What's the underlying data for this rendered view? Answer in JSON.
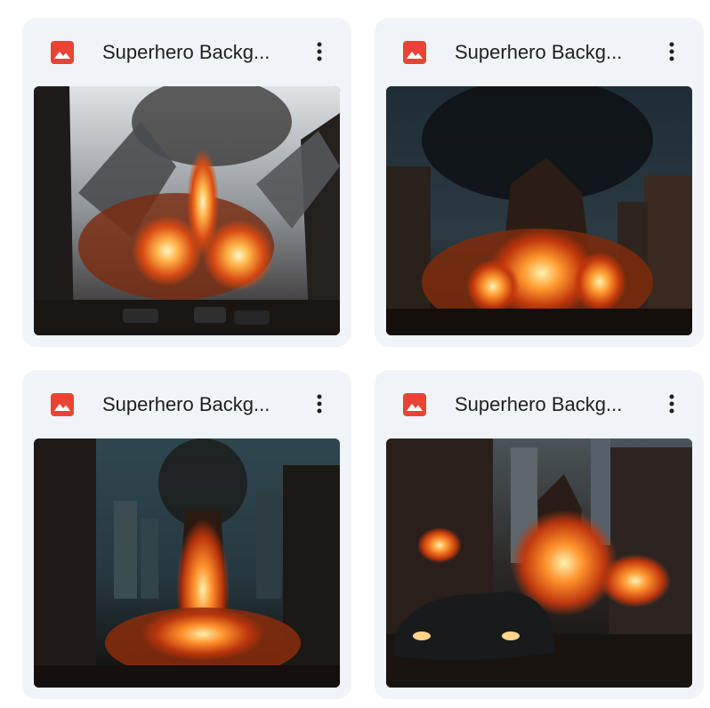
{
  "files": [
    {
      "name": "Superhero Backg...",
      "type_icon": "image-file-icon",
      "thumbnail": "city-explosion-debris"
    },
    {
      "name": "Superhero Backg...",
      "type_icon": "image-file-icon",
      "thumbnail": "city-fire-night"
    },
    {
      "name": "Superhero Backg...",
      "type_icon": "image-file-icon",
      "thumbnail": "burning-tower-street"
    },
    {
      "name": "Superhero Backg...",
      "type_icon": "image-file-icon",
      "thumbnail": "car-in-burning-street"
    }
  ],
  "colors": {
    "card_bg": "#f0f4f9",
    "icon_red": "#ea4335",
    "text": "#1f1f1f"
  }
}
